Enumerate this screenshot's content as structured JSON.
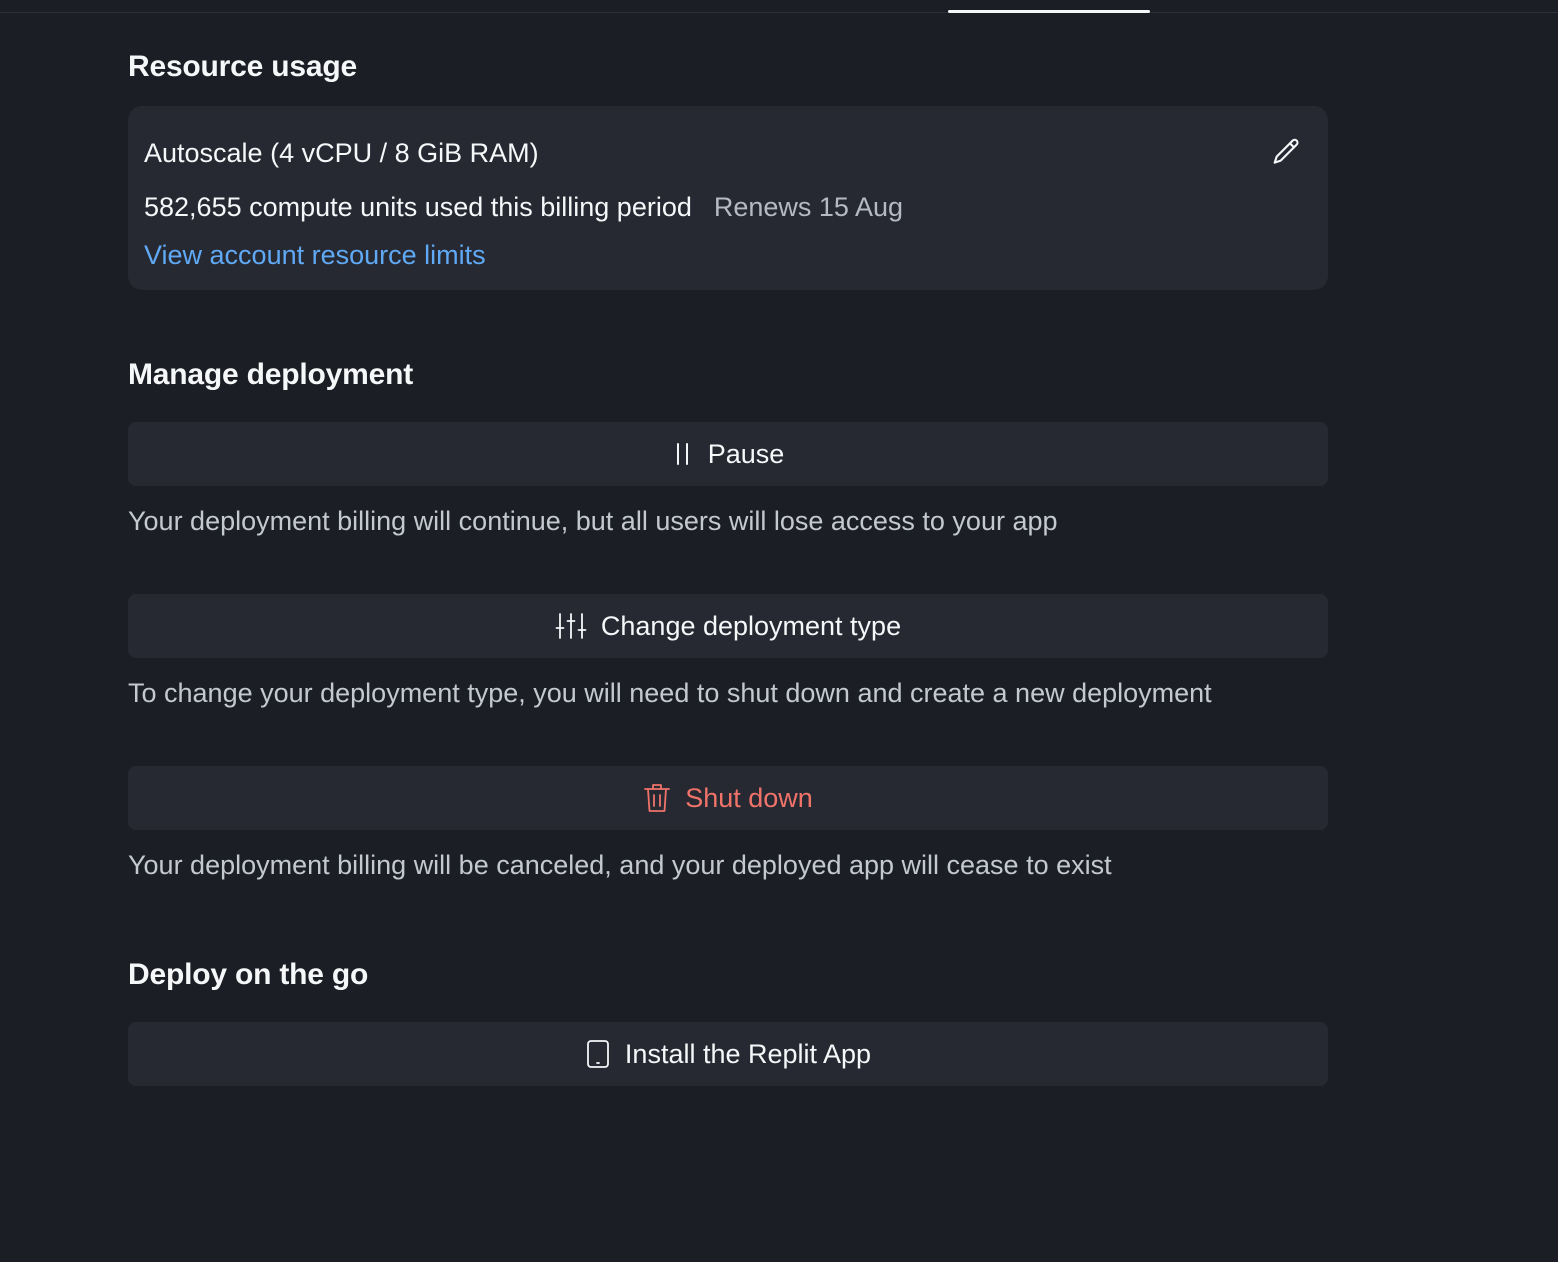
{
  "resource_usage": {
    "title": "Resource usage",
    "plan": "Autoscale (4 vCPU / 8 GiB RAM)",
    "compute_units": "582,655 compute units used this billing period",
    "renews": "Renews 15 Aug",
    "limits_link": "View account resource limits",
    "edit_icon": "pencil-icon"
  },
  "manage": {
    "title": "Manage deployment",
    "pause": {
      "label": "Pause",
      "icon": "pause-icon",
      "description": "Your deployment billing will continue, but all users will lose access to your app"
    },
    "change_type": {
      "label": "Change deployment type",
      "icon": "sliders-icon",
      "description": "To change your deployment type, you will need to shut down and create a new deployment"
    },
    "shutdown": {
      "label": "Shut down",
      "icon": "trash-icon",
      "description": "Your deployment billing will be canceled, and your deployed app will cease to exist"
    }
  },
  "deploy_go": {
    "title": "Deploy on the go",
    "install": {
      "label": "Install the Replit App",
      "icon": "phone-icon"
    }
  },
  "colors": {
    "background": "#1c1e25",
    "card": "#262932",
    "link": "#5fa9f5",
    "danger": "#f0736a"
  }
}
